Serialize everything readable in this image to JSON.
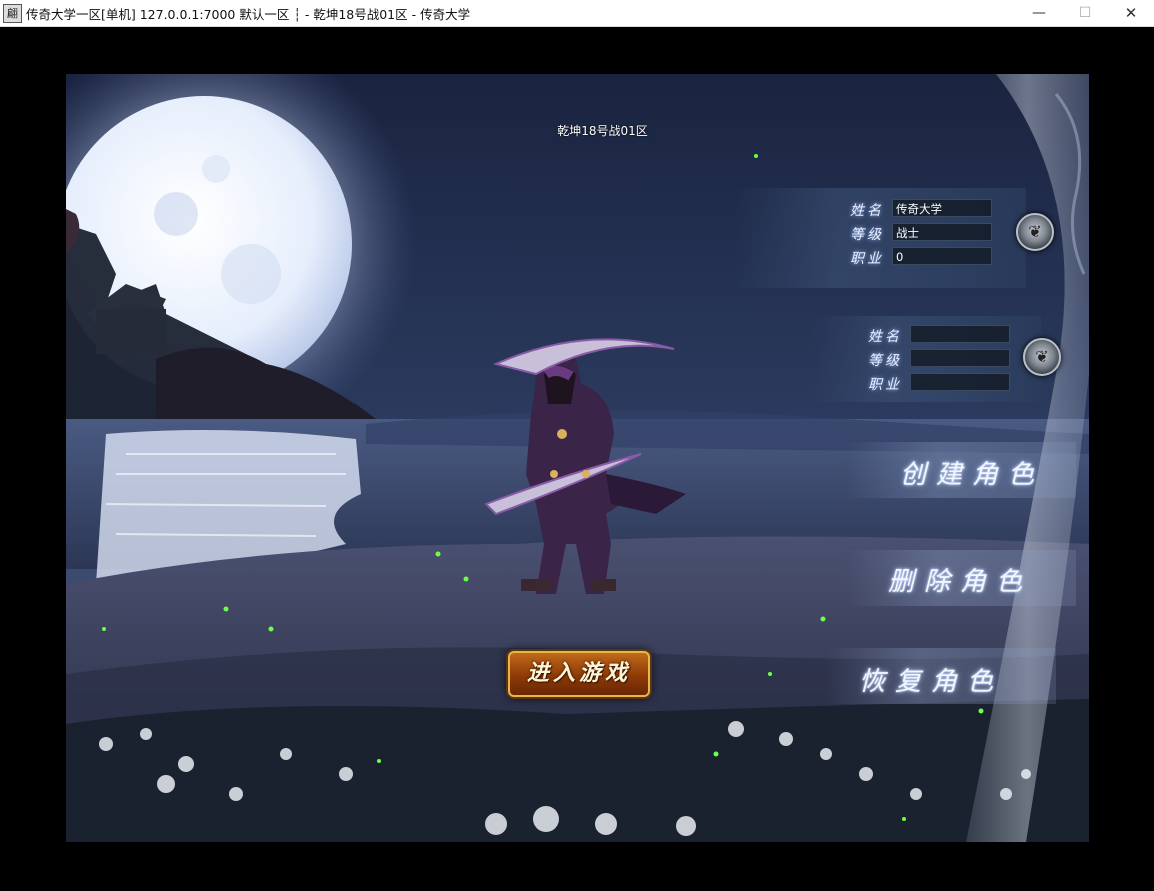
{
  "window": {
    "icon_glyph": "翩",
    "title": "传奇大学一区[单机] 127.0.0.1:7000  默认一区 ┆ - 乾坤18号战01区 - 传奇大学",
    "minimize": "—",
    "maximize": "☐",
    "close": "✕"
  },
  "game": {
    "server_name": "乾坤18号战01区",
    "slot1": {
      "name_label": "姓名",
      "level_label": "等级",
      "job_label": "职业",
      "name": "传奇大学",
      "level": "战士",
      "job": "0"
    },
    "slot2": {
      "name_label": "姓名",
      "level_label": "等级",
      "job_label": "职业",
      "name": "",
      "level": "",
      "job": ""
    },
    "buttons": {
      "create": "创建角色",
      "delete": "删除角色",
      "restore": "恢复角色",
      "enter": "进入游戏"
    }
  }
}
